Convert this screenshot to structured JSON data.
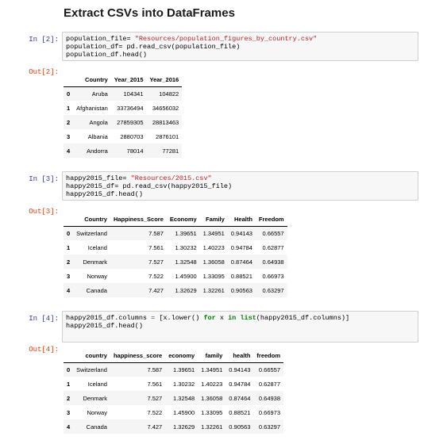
{
  "heading": "Extract CSVs into DataFrames",
  "cells": [
    {
      "in_prompt": "In [2]:",
      "out_prompt": "Out[2]:",
      "code": [
        [
          {
            "t": "population_file= ",
            "c": ""
          },
          {
            "t": "\"Resources/population_figures_by_country.csv\"",
            "c": "str"
          }
        ],
        [
          {
            "t": "population_df= pd.read_csv(population_file)",
            "c": ""
          }
        ],
        [
          {
            "t": "population_df.head()",
            "c": ""
          }
        ]
      ],
      "table": {
        "columns": [
          "Country",
          "Year_2015",
          "Year_2016"
        ],
        "rows": [
          [
            "0",
            "Aruba",
            "104341",
            "104822"
          ],
          [
            "1",
            "Afghanistan",
            "33736494",
            "34656032"
          ],
          [
            "2",
            "Angola",
            "27859305",
            "28813463"
          ],
          [
            "3",
            "Albania",
            "2880703",
            "2876101"
          ],
          [
            "4",
            "Andorra",
            "78014",
            "77281"
          ]
        ]
      }
    },
    {
      "in_prompt": "In [3]:",
      "out_prompt": "Out[3]:",
      "code": [
        [
          {
            "t": "happy2015_file= ",
            "c": ""
          },
          {
            "t": "\"Resources/2015.csv\"",
            "c": "str"
          }
        ],
        [
          {
            "t": "happy2015_df= pd.read_csv(happy2015_file)",
            "c": ""
          }
        ],
        [
          {
            "t": "happy2015_df.head()",
            "c": ""
          }
        ]
      ],
      "table": {
        "columns": [
          "Country",
          "Happiness_Score",
          "Economy",
          "Family",
          "Health",
          "Freedom"
        ],
        "rows": [
          [
            "0",
            "Switzerland",
            "7.587",
            "1.39651",
            "1.34951",
            "0.94143",
            "0.66557"
          ],
          [
            "1",
            "Iceland",
            "7.561",
            "1.30232",
            "1.40223",
            "0.94784",
            "0.62877"
          ],
          [
            "2",
            "Denmark",
            "7.527",
            "1.32548",
            "1.36058",
            "0.87464",
            "0.64938"
          ],
          [
            "3",
            "Norway",
            "7.522",
            "1.45900",
            "1.33095",
            "0.88521",
            "0.66973"
          ],
          [
            "4",
            "Canada",
            "7.427",
            "1.32629",
            "1.32261",
            "0.90563",
            "0.63297"
          ]
        ]
      }
    },
    {
      "in_prompt": "In [4]:",
      "out_prompt": "Out[4]:",
      "code": [
        [
          {
            "t": "happy2015_df.columns ",
            "c": ""
          },
          {
            "t": "=",
            "c": "op"
          },
          {
            "t": " [x.lower() ",
            "c": ""
          },
          {
            "t": "for",
            "c": "kw"
          },
          {
            "t": " x ",
            "c": ""
          },
          {
            "t": "in",
            "c": "kw"
          },
          {
            "t": " ",
            "c": ""
          },
          {
            "t": "list",
            "c": "kw"
          },
          {
            "t": "(happy2015_df.columns)]",
            "c": ""
          }
        ],
        [
          {
            "t": "happy2015_df.head()",
            "c": ""
          }
        ]
      ],
      "table": {
        "columns": [
          "country",
          "happiness_score",
          "economy",
          "family",
          "health",
          "freedom"
        ],
        "rows": [
          [
            "0",
            "Switzerland",
            "7.587",
            "1.39651",
            "1.34951",
            "0.94143",
            "0.66557"
          ],
          [
            "1",
            "Iceland",
            "7.561",
            "1.30232",
            "1.40223",
            "0.94784",
            "0.62877"
          ],
          [
            "2",
            "Denmark",
            "7.527",
            "1.32548",
            "1.36058",
            "0.87464",
            "0.64938"
          ],
          [
            "3",
            "Norway",
            "7.522",
            "1.45900",
            "1.33095",
            "0.88521",
            "0.66973"
          ],
          [
            "4",
            "Canada",
            "7.427",
            "1.32629",
            "1.32261",
            "0.90563",
            "0.63297"
          ]
        ]
      }
    }
  ]
}
